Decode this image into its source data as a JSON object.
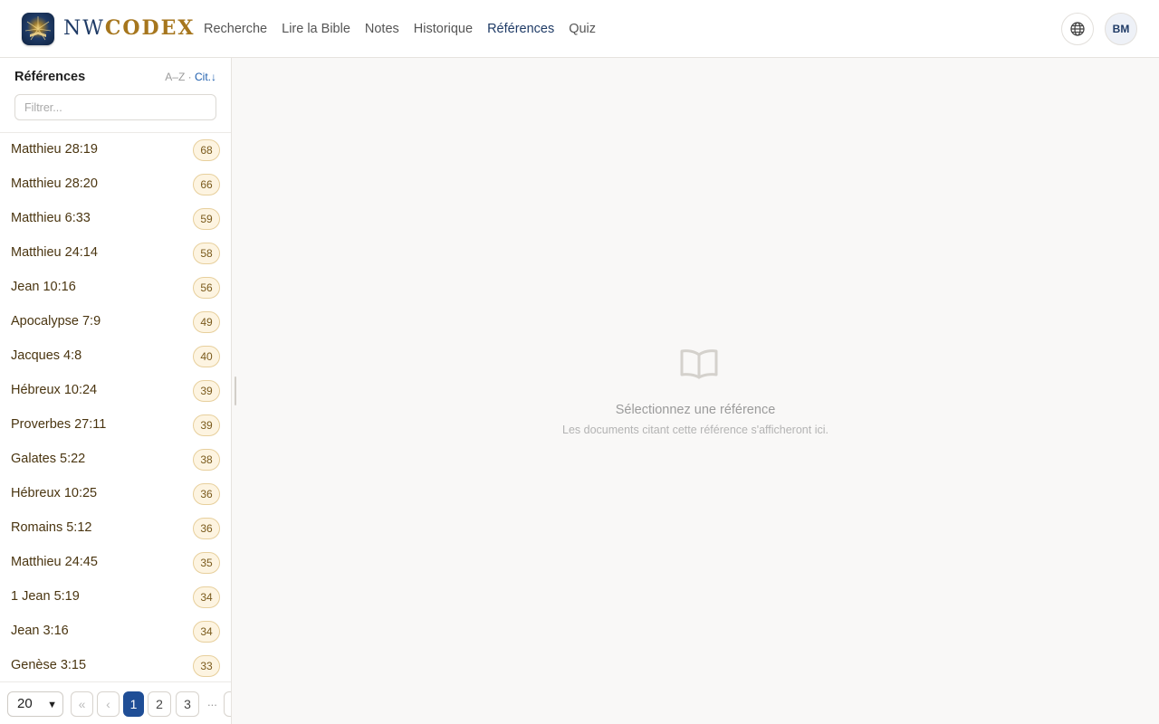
{
  "header": {
    "brand_left": "NW",
    "brand_right": "CODEX",
    "nav": [
      {
        "label": "Recherche",
        "active": false
      },
      {
        "label": "Lire la Bible",
        "active": false
      },
      {
        "label": "Notes",
        "active": false
      },
      {
        "label": "Historique",
        "active": false
      },
      {
        "label": "Références",
        "active": true
      },
      {
        "label": "Quiz",
        "active": false
      }
    ],
    "globe_icon": "globe-icon",
    "avatar_initials": "BM"
  },
  "sidebar": {
    "title": "Références",
    "sort_az": "A–Z",
    "sort_sep": "·",
    "sort_cit": "Cit.↓",
    "filter_placeholder": "Filtrer...",
    "references": [
      {
        "label": "Matthieu 28:19",
        "count": "68"
      },
      {
        "label": "Matthieu 28:20",
        "count": "66"
      },
      {
        "label": "Matthieu 6:33",
        "count": "59"
      },
      {
        "label": "Matthieu 24:14",
        "count": "58"
      },
      {
        "label": "Jean 10:16",
        "count": "56"
      },
      {
        "label": "Apocalypse 7:9",
        "count": "49"
      },
      {
        "label": "Jacques 4:8",
        "count": "40"
      },
      {
        "label": "Hébreux 10:24",
        "count": "39"
      },
      {
        "label": "Proverbes 27:11",
        "count": "39"
      },
      {
        "label": "Galates 5:22",
        "count": "38"
      },
      {
        "label": "Hébreux 10:25",
        "count": "36"
      },
      {
        "label": "Romains 5:12",
        "count": "36"
      },
      {
        "label": "Matthieu 24:45",
        "count": "35"
      },
      {
        "label": "1 Jean 5:19",
        "count": "34"
      },
      {
        "label": "Jean 3:16",
        "count": "34"
      },
      {
        "label": "Genèse 3:15",
        "count": "33"
      }
    ],
    "pagination": {
      "per_page": "20",
      "first": "«",
      "prev": "‹",
      "pages": [
        "1",
        "2",
        "3"
      ],
      "current": "1",
      "ellipsis": "..."
    }
  },
  "main": {
    "empty_icon": "book-open-icon",
    "empty_title": "Sélectionnez une référence",
    "empty_subtitle": "Les documents citant cette référence s'afficheront ici."
  },
  "colors": {
    "accent": "#1f4e96",
    "brand_gold": "#a6761d",
    "brand_navy": "#1f3b66",
    "badge_bg": "#fdf4e1"
  }
}
